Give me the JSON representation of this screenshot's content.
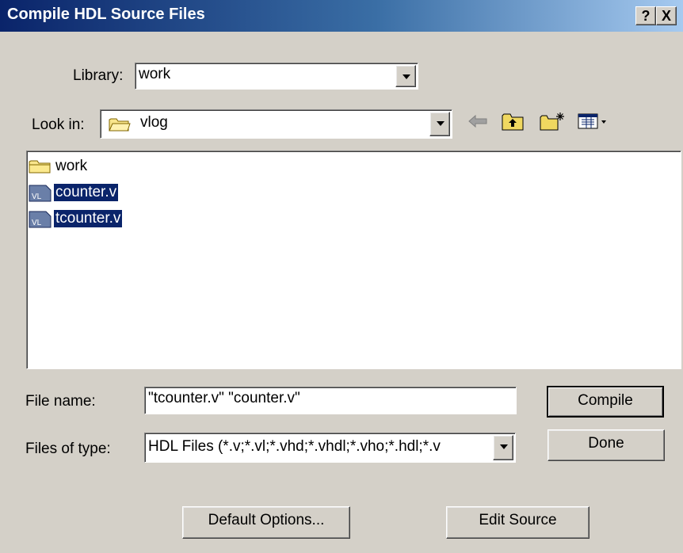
{
  "window": {
    "title": "Compile HDL Source Files",
    "help_btn": "?",
    "close_btn": "X"
  },
  "library": {
    "label": "Library:",
    "value": "work"
  },
  "lookin": {
    "label": "Look in:",
    "value": "vlog"
  },
  "files": [
    {
      "name": "work",
      "icon": "folder-icon",
      "selected": false
    },
    {
      "name": "counter.v",
      "icon": "verilog-file-icon",
      "selected": true
    },
    {
      "name": "tcounter.v",
      "icon": "verilog-file-icon",
      "selected": true
    }
  ],
  "filename": {
    "label": "File name:",
    "value": "\"tcounter.v\" \"counter.v\""
  },
  "filetype": {
    "label": "Files of type:",
    "value": "HDL Files (*.v;*.vl;*.vhd;*.vhdl;*.vho;*.hdl;*.v"
  },
  "buttons": {
    "compile": "Compile",
    "done": "Done",
    "default_options": "Default Options...",
    "edit_source": "Edit Source"
  },
  "icons": {
    "file_badge": "VL"
  }
}
